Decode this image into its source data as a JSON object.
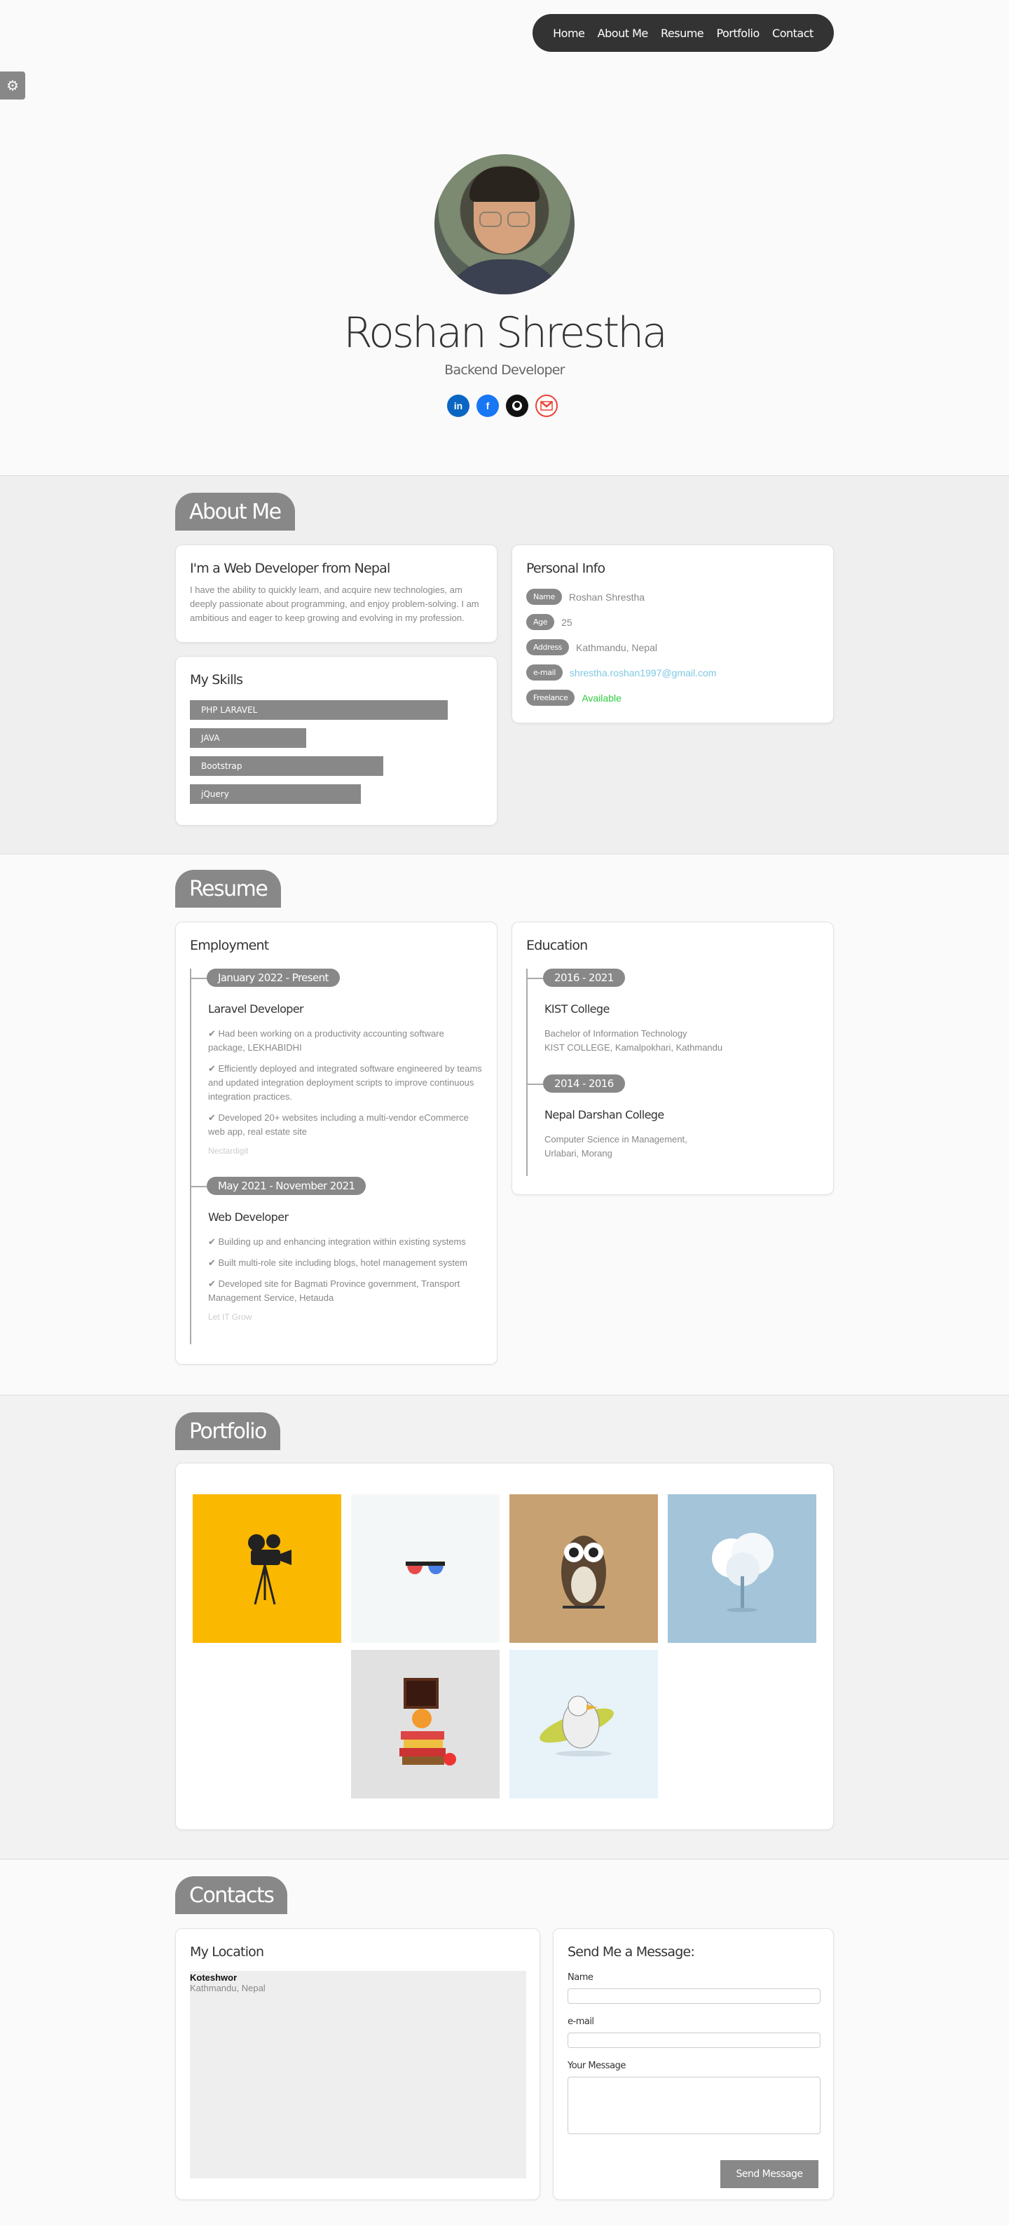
{
  "nav": {
    "items": [
      "Home",
      "About Me",
      "Resume",
      "Portfolio",
      "Contact"
    ]
  },
  "settings_icon": "gears-icon",
  "hero": {
    "name": "Roshan Shrestha",
    "role": "Backend Developer",
    "socials": [
      "linkedin-icon",
      "facebook-icon",
      "github-icon",
      "gmail-icon"
    ]
  },
  "about": {
    "heading": "About Me",
    "intro_title": "I'm a Web Developer from Nepal",
    "intro_text": "I have the ability to quickly learn, and acquire new technologies, am deeply passionate about programming, and enjoy problem-solving. I am ambitious and eager to keep growing and evolving in my profession.",
    "skills_title": "My Skills",
    "skills": [
      {
        "name": "PHP LARAVEL",
        "level": 0.8
      },
      {
        "name": "JAVA",
        "level": 0.36
      },
      {
        "name": "Bootstrap",
        "level": 0.6
      },
      {
        "name": "jQuery",
        "level": 0.53
      }
    ],
    "info_title": "Personal Info",
    "info": [
      {
        "label": "Name",
        "value": "Roshan Shrestha"
      },
      {
        "label": "Age",
        "value": "25"
      },
      {
        "label": "Address",
        "value": "Kathmandu, Nepal"
      },
      {
        "label": "e-mail",
        "value": "shrestha.roshan1997@gmail.com"
      },
      {
        "label": "Freelance",
        "value": "Available"
      }
    ]
  },
  "resume": {
    "heading": "Resume",
    "employment_title": "Employment",
    "jobs": [
      {
        "date": "January 2022 - Present",
        "title": "Laravel Developer",
        "bullets": [
          "✔ Had been working on a productivity accounting software package, LEKHABIDHI",
          "✔ Efficiently deployed and integrated software engineered by teams and updated integration deployment scripts to improve continuous integration practices.",
          "✔ Developed 20+ websites including a multi-vendor eCommerce web app, real estate site"
        ],
        "company": "Nectardigit"
      },
      {
        "date": "May 2021 - November 2021",
        "title": "Web Developer",
        "bullets": [
          "✔ Building up and enhancing integration within existing systems",
          "✔ Built multi-role site including blogs, hotel management system",
          "✔ Developed site for Bagmati Province government, Transport Management Service, Hetauda"
        ],
        "company": "Let IT Grow"
      }
    ],
    "education_title": "Education",
    "schools": [
      {
        "date": "2016 - 2021",
        "title": "KIST College",
        "lines": [
          "Bachelor of Information Technology",
          "KIST COLLEGE, Kamalpokhari, Kathmandu"
        ]
      },
      {
        "date": "2014 - 2016",
        "title": "Nepal Darshan College",
        "lines": [
          "Computer Science in Management,",
          "Urlabari, Morang"
        ]
      }
    ]
  },
  "portfolio": {
    "heading": "Portfolio",
    "items": [
      {
        "icon": "movie-camera-icon",
        "bg": "#fbb800"
      },
      {
        "icon": "3d-glasses-icon",
        "bg": "#f4f7f8"
      },
      {
        "icon": "owl-icon",
        "bg": "#c8a173"
      },
      {
        "icon": "tree-icon",
        "bg": "#a3c4d9"
      },
      {
        "icon": "books-apple-icon",
        "bg": "#e1e1e1"
      },
      {
        "icon": "surfer-bird-icon",
        "bg": "#e8f2f9"
      }
    ]
  },
  "contacts": {
    "heading": "Contacts",
    "location_title": "My Location",
    "map_place": "Koteshwor",
    "map_sub": "Kathmandu, Nepal",
    "message_title": "Send Me a Message:",
    "name_label": "Name",
    "email_label": "e-mail",
    "message_label": "Your Message",
    "send_label": "Send Message"
  },
  "colors": {
    "accent": "#888888",
    "available": "#2ecc40",
    "email": "#7ec8e3"
  }
}
